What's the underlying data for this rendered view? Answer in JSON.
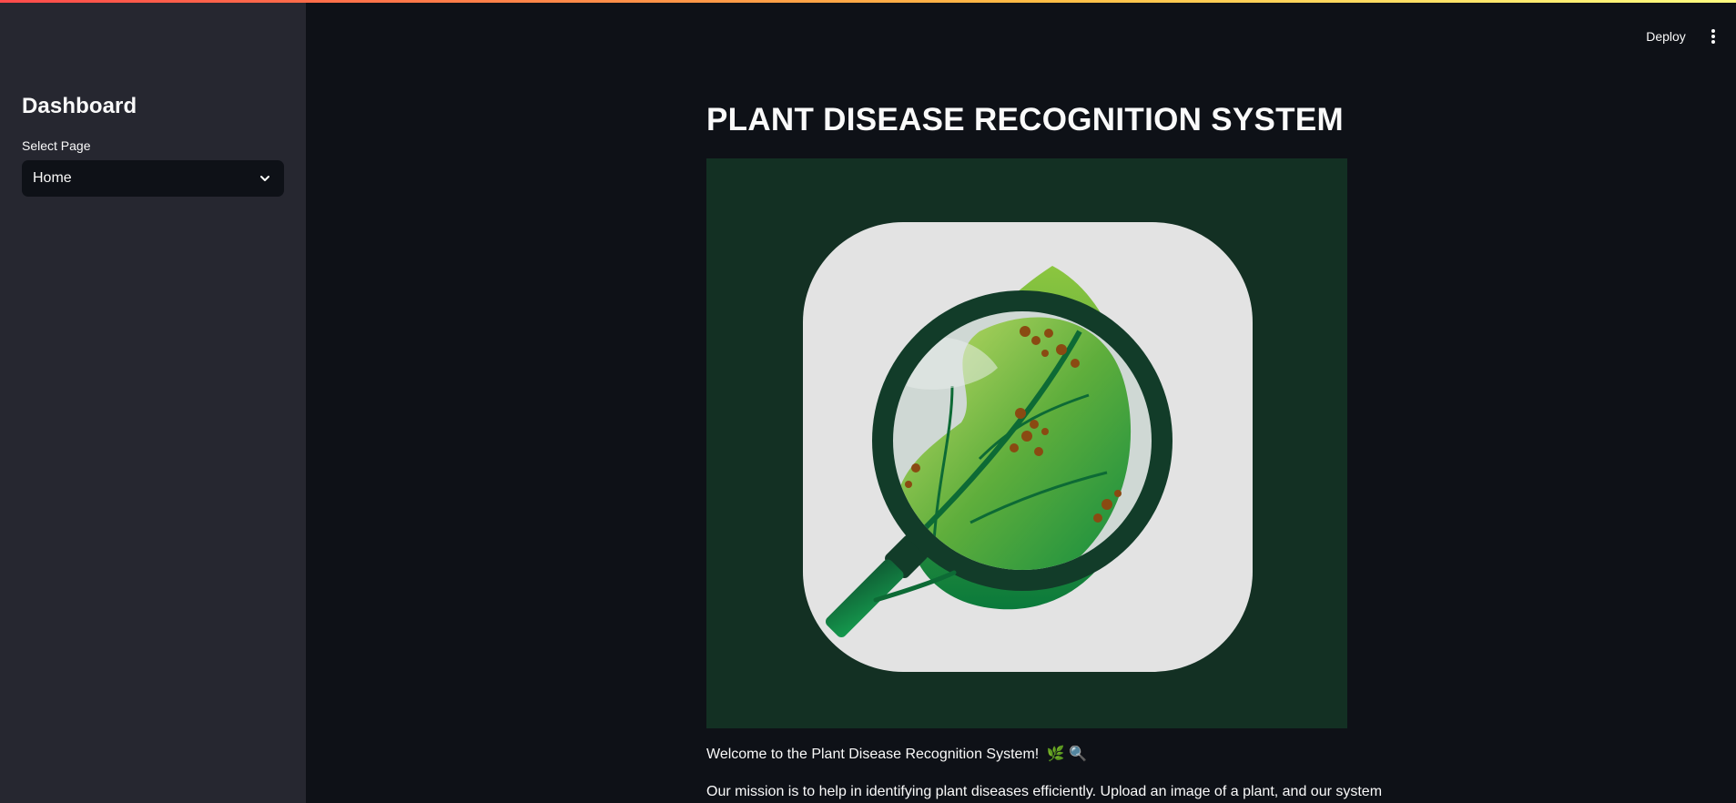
{
  "sidebar": {
    "title": "Dashboard",
    "select_label": "Select Page",
    "select_value": "Home",
    "chevron_icon": "chevron-down-icon"
  },
  "header": {
    "deploy_label": "Deploy",
    "menu_icon": "more-vertical-icon"
  },
  "main": {
    "title": "PLANT DISEASE RECOGNITION SYSTEM",
    "image": {
      "icon": "leaf-magnifier-logo"
    },
    "welcome": "Welcome to the Plant Disease Recognition System!",
    "welcome_emojis": "🌿 🔍",
    "mission": "Our mission is to help in identifying plant diseases efficiently. Upload an image of a plant, and our system"
  },
  "colors": {
    "background": "#0e1117",
    "sidebar": "#262730",
    "image_background": "#133023",
    "accent": "#ff4b4b"
  }
}
